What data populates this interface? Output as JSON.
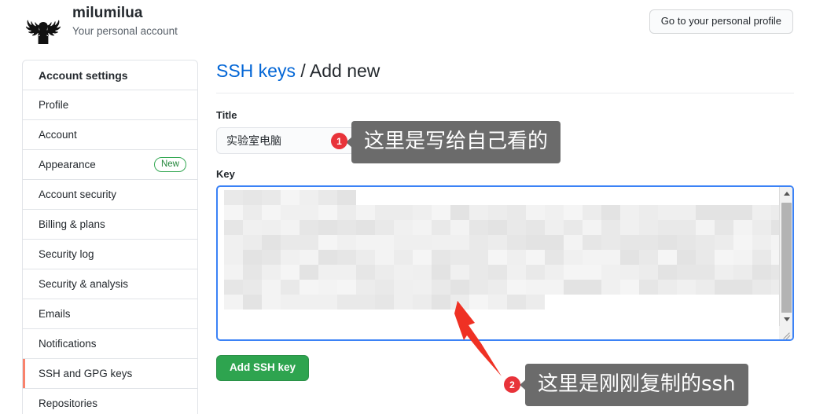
{
  "header": {
    "avatar_icon": "deer-antlers-logo",
    "account_name": "milumilua",
    "account_subtitle": "Your personal account",
    "profile_button": "Go to your personal profile"
  },
  "sidebar": {
    "items": [
      {
        "label": "Account settings",
        "is_header": true,
        "active": false,
        "badge": ""
      },
      {
        "label": "Profile",
        "is_header": false,
        "active": false,
        "badge": ""
      },
      {
        "label": "Account",
        "is_header": false,
        "active": false,
        "badge": ""
      },
      {
        "label": "Appearance",
        "is_header": false,
        "active": false,
        "badge": "New"
      },
      {
        "label": "Account security",
        "is_header": false,
        "active": false,
        "badge": ""
      },
      {
        "label": "Billing & plans",
        "is_header": false,
        "active": false,
        "badge": ""
      },
      {
        "label": "Security log",
        "is_header": false,
        "active": false,
        "badge": ""
      },
      {
        "label": "Security & analysis",
        "is_header": false,
        "active": false,
        "badge": ""
      },
      {
        "label": "Emails",
        "is_header": false,
        "active": false,
        "badge": ""
      },
      {
        "label": "Notifications",
        "is_header": false,
        "active": false,
        "badge": ""
      },
      {
        "label": "SSH and GPG keys",
        "is_header": false,
        "active": true,
        "badge": ""
      },
      {
        "label": "Repositories",
        "is_header": false,
        "active": false,
        "badge": ""
      }
    ]
  },
  "main": {
    "breadcrumb_link": "SSH keys",
    "breadcrumb_separator": " / ",
    "breadcrumb_current": "Add new",
    "title_label": "Title",
    "title_value": "实验室电脑",
    "title_placeholder": "",
    "key_label": "Key",
    "key_value": "",
    "key_placeholder": "",
    "submit_label": "Add SSH key"
  },
  "annotations": [
    {
      "number": "1",
      "text": "这里是写给自己看的"
    },
    {
      "number": "2",
      "text": "这里是刚刚复制的ssh"
    }
  ],
  "colors": {
    "accent_link": "#0366d6",
    "active_marker": "#f9826c",
    "submit_green": "#2ea44f",
    "badge_red": "#e8333a",
    "annotation_gray": "#6b6b6b",
    "focus_blue": "#3b82f6",
    "arrow_red": "#ef3124"
  }
}
